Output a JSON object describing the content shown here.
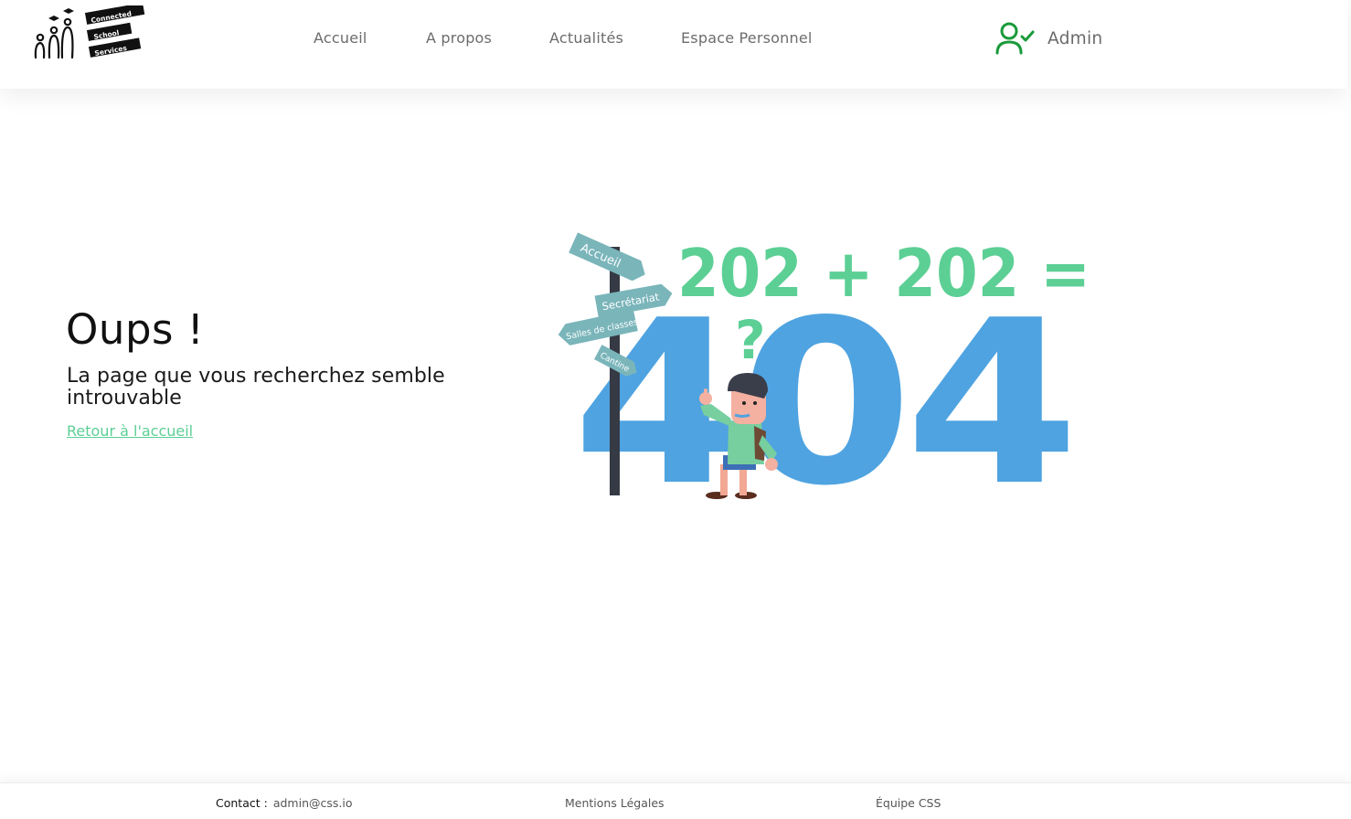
{
  "header": {
    "logo": {
      "words": [
        "Connected",
        "School",
        "Services"
      ]
    },
    "nav": [
      "Accueil",
      "A propos",
      "Actualités",
      "Espace Personnel"
    ],
    "user": {
      "name": "Admin",
      "icon": "user-check-icon",
      "icon_color": "#1a9a3a"
    }
  },
  "main": {
    "title": "Oups !",
    "subtitle": "La page que vous recherchez semble introuvable",
    "back_link": "Retour à l'accueil",
    "illustration": {
      "equation": "202 + 202 =",
      "big_number": "404",
      "question_mark": "?",
      "signs": [
        "Accueil",
        "Secrétariat",
        "Salles de classes",
        "Cantine"
      ],
      "colors": {
        "equation": "#5ccf95",
        "number": "#4fa3e0",
        "sign": "#7ab5ba",
        "post": "#353a45"
      }
    }
  },
  "footer": {
    "contact_label": "Contact :",
    "contact_email": "admin@css.io",
    "legal": "Mentions Légales",
    "team": "Équipe CSS"
  },
  "colors": {
    "accent": "#5ccf95",
    "text": "#111111",
    "muted": "#6c6c6c"
  }
}
